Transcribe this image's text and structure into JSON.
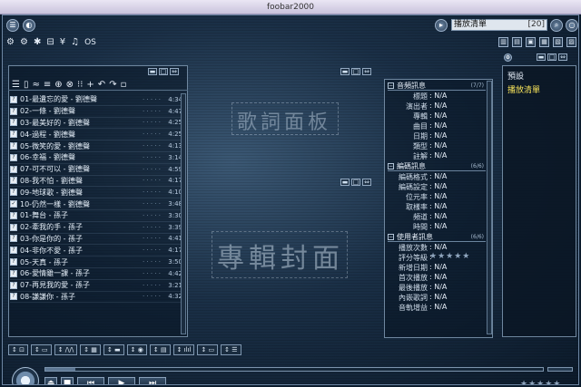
{
  "window": {
    "title": "foobar2000"
  },
  "toolbar": {
    "top_text": "OS",
    "search_value": "播放清單",
    "search_count": "[20]"
  },
  "icons": {
    "menu": "☰",
    "prefs": "⚙",
    "gear": "✱",
    "wifi": "⌁",
    "note": "♫",
    "close": "✕",
    "add": "+"
  },
  "playlist": {
    "tracks": [
      {
        "num": "?",
        "title": "01-最遺忘的愛 - 劉德聲",
        "dur": "4:34"
      },
      {
        "num": "?",
        "title": "02-一條 - 劉德聲",
        "dur": "4:47"
      },
      {
        "num": "?",
        "title": "03-最美好的 - 劉德聲",
        "dur": "4:25"
      },
      {
        "num": "?",
        "title": "04-過程 - 劉德聲",
        "dur": "4:25"
      },
      {
        "num": "?",
        "title": "05-微笑的愛 - 劉德聲",
        "dur": "4:13"
      },
      {
        "num": "?",
        "title": "06-幸福 - 劉德聲",
        "dur": "3:14"
      },
      {
        "num": "?",
        "title": "07-可不可以 - 劉德聲",
        "dur": "4:59"
      },
      {
        "num": "?",
        "title": "08-我不怕 - 劉德聲",
        "dur": "4:17"
      },
      {
        "num": "?",
        "title": "09-地球歌 - 劉德聲",
        "dur": "4:10"
      },
      {
        "num": "✓",
        "title": "10-仍然一樣 - 劉德聲",
        "dur": "3:48"
      },
      {
        "num": "?",
        "title": "01-舞台 - 孫子",
        "dur": "3:30"
      },
      {
        "num": "?",
        "title": "02-牽我的手 - 孫子",
        "dur": "3:39"
      },
      {
        "num": "?",
        "title": "03-你是你的 - 孫子",
        "dur": "4:41"
      },
      {
        "num": "?",
        "title": "04-非你不愛 - 孫子",
        "dur": "4:17"
      },
      {
        "num": "?",
        "title": "05-天真 - 孫子",
        "dur": "3:50"
      },
      {
        "num": "?",
        "title": "06-愛情雖一課 - 孫子",
        "dur": "4:42"
      },
      {
        "num": "?",
        "title": "07-再見我的愛 - 孫子",
        "dur": "3:21"
      },
      {
        "num": "?",
        "title": "08-謙謙你 - 孫子",
        "dur": "4:32"
      }
    ]
  },
  "panels": {
    "lyrics": "歌詞面板",
    "cover": "專輯封面"
  },
  "info": {
    "audio_header": "音頻訊息",
    "audio_tag": "(7/7)",
    "audio_rows": [
      {
        "k": "標題",
        "v": ": N/A"
      },
      {
        "k": "演出者",
        "v": ": N/A"
      },
      {
        "k": "專輯",
        "v": ": N/A"
      },
      {
        "k": "曲目",
        "v": ": N/A"
      },
      {
        "k": "日期",
        "v": ": N/A"
      },
      {
        "k": "類型",
        "v": ": N/A"
      },
      {
        "k": "註解",
        "v": ": N/A"
      }
    ],
    "codec_header": "編碼訊息",
    "codec_tag": "(6/6)",
    "codec_rows": [
      {
        "k": "編碼格式",
        "v": ": N/A"
      },
      {
        "k": "編碼設定",
        "v": ": N/A"
      },
      {
        "k": "位元率",
        "v": ": N/A"
      },
      {
        "k": "取樣率",
        "v": ": N/A"
      },
      {
        "k": "頻道",
        "v": ": N/A"
      },
      {
        "k": "時間",
        "v": ": N/A"
      }
    ],
    "usage_header": "使用者訊息",
    "usage_tag": "(6/6)",
    "usage_rows": [
      {
        "k": "播放次數",
        "v": ": N/A"
      },
      {
        "k": "評分等級",
        "v": ":"
      },
      {
        "k": "新增日期",
        "v": ": N/A"
      },
      {
        "k": "首次播放",
        "v": ": N/A"
      },
      {
        "k": "最後播放",
        "v": ": N/A"
      },
      {
        "k": "內嵌歌詞",
        "v": ": N/A"
      },
      {
        "k": "音軌增益",
        "v": ": N/A"
      },
      {
        "k": "專輯增益",
        "v": ": N/A"
      }
    ],
    "rating_stars": "★★★★★"
  },
  "side_list": {
    "items": [
      "預設",
      "播放清單"
    ]
  },
  "controls": {
    "layout_buttons": [
      "↕ ⊡",
      "↕ ▭",
      "↕ /\\/\\",
      "↕ ▦",
      "↕ ▬",
      "↕ ◉",
      "↕ ▤",
      "↕ ılıl",
      "↕ ▭",
      "↕ ☰"
    ],
    "transport": [
      "⏏",
      "■",
      "⏮",
      "▶",
      "⏭"
    ],
    "rating": "★★★★★",
    "status": "......"
  },
  "colors": {
    "accent_yellow": "#f5e15a",
    "panel_border": "#6f879f"
  }
}
